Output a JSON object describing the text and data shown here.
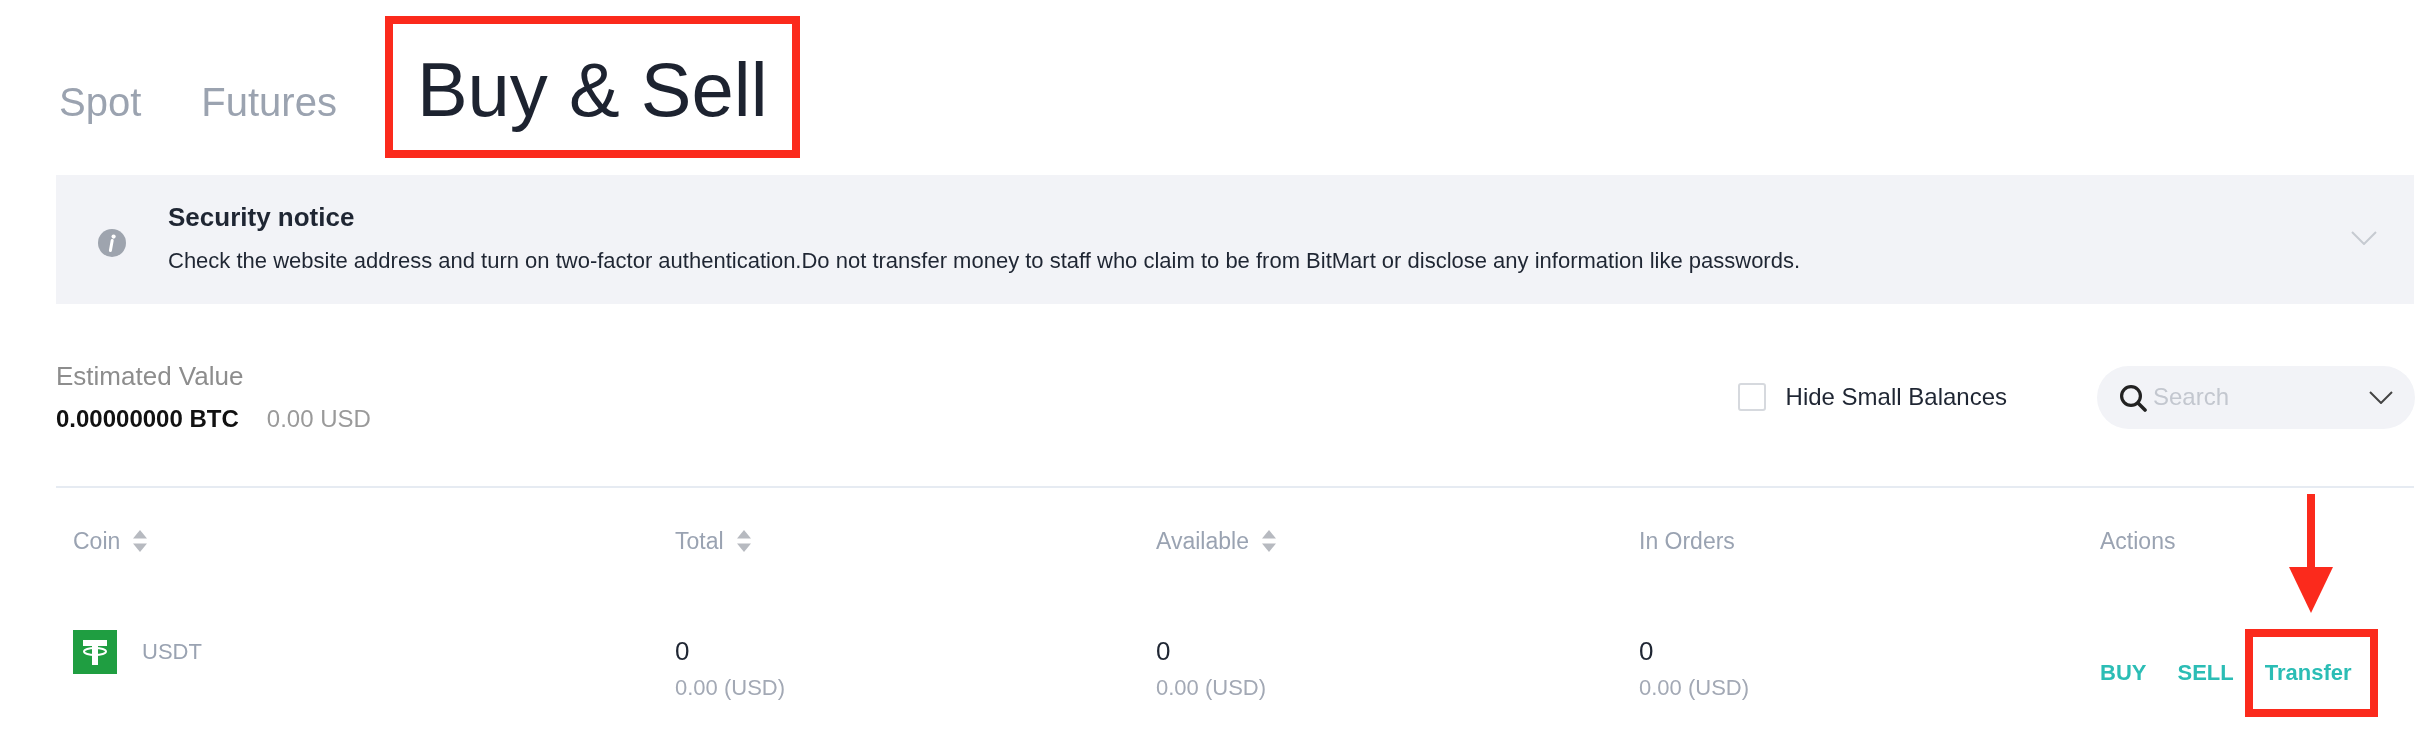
{
  "tabs": [
    {
      "label": "Spot",
      "selected": false,
      "highlighted": false
    },
    {
      "label": "Futures",
      "selected": false,
      "highlighted": false
    },
    {
      "label": "Buy & Sell",
      "selected": true,
      "highlighted": true
    }
  ],
  "notice": {
    "title": "Security notice",
    "text": "Check the website address and turn on two-factor authentication.Do not transfer money to staff who claim to be from BitMart or disclose any information like passwords.",
    "expanded": false
  },
  "estimated_value": {
    "label": "Estimated Value",
    "btc": "0.00000000 BTC",
    "usd": "0.00 USD"
  },
  "hide_small_balances": {
    "label": "Hide Small Balances",
    "checked": false
  },
  "search": {
    "placeholder": "Search"
  },
  "table": {
    "columns": [
      {
        "label": "Coin",
        "sortable": true
      },
      {
        "label": "Total",
        "sortable": true
      },
      {
        "label": "Available",
        "sortable": true
      },
      {
        "label": "In Orders",
        "sortable": false
      },
      {
        "label": "Actions",
        "sortable": false
      }
    ],
    "rows": [
      {
        "coin": "USDT",
        "amounts": [
          {
            "value": "0",
            "usd": "0.00 (USD)"
          },
          {
            "value": "0",
            "usd": "0.00 (USD)"
          },
          {
            "value": "0",
            "usd": "0.00 (USD)"
          }
        ],
        "actions": [
          {
            "label": "BUY",
            "highlighted": false,
            "arrow": false
          },
          {
            "label": "SELL",
            "highlighted": false,
            "arrow": false
          },
          {
            "label": "Transfer",
            "highlighted": true,
            "arrow": true
          }
        ]
      }
    ]
  }
}
